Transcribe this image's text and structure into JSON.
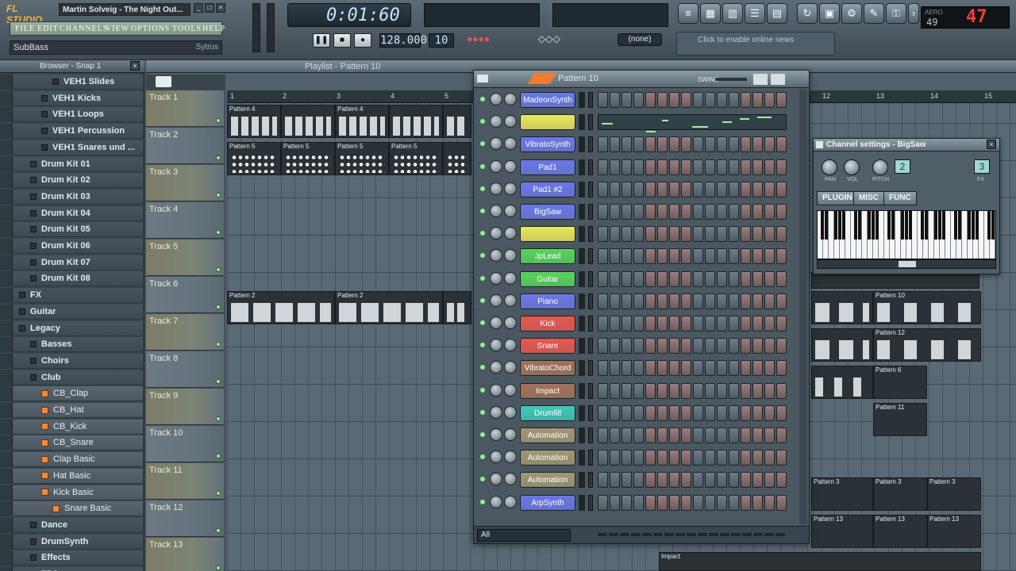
{
  "title": {
    "app": "FL STUDIO",
    "song": "Martin Solveig - The Night Out..."
  },
  "menu": [
    "FILE",
    "EDIT",
    "CHANNELS",
    "VIEW",
    "OPTIONS",
    "TOOLS",
    "HELP"
  ],
  "hint": {
    "left": "SubBass",
    "right": "Sytrus"
  },
  "transport": {
    "time": "0:01:60",
    "tempo": "128.000",
    "pattern": "10",
    "none_label": "(none)",
    "news": "Click to enable online news"
  },
  "cpu": {
    "label": "AERO",
    "value": "49",
    "big": "47"
  },
  "browser": {
    "title": "Browser - Snap 1",
    "items": [
      {
        "label": "VEH1 Slides",
        "type": "folder",
        "indent": 3
      },
      {
        "label": "VEH1 Kicks",
        "type": "folder",
        "indent": 2
      },
      {
        "label": "VEH1 Loops",
        "type": "folder",
        "indent": 2
      },
      {
        "label": "VEH1 Percussion",
        "type": "folder",
        "indent": 2
      },
      {
        "label": "VEH1 Snares und ...",
        "type": "folder",
        "indent": 2
      },
      {
        "label": "Drum Kit 01",
        "type": "folder",
        "indent": 1
      },
      {
        "label": "Drum Kit 02",
        "type": "folder",
        "indent": 1
      },
      {
        "label": "Drum Kit 03",
        "type": "folder",
        "indent": 1
      },
      {
        "label": "Drum Kit 04",
        "type": "folder",
        "indent": 1
      },
      {
        "label": "Drum Kit 05",
        "type": "folder",
        "indent": 1
      },
      {
        "label": "Drum Kit 06",
        "type": "folder",
        "indent": 1
      },
      {
        "label": "Drum Kit 07",
        "type": "folder",
        "indent": 1
      },
      {
        "label": "Drum Kit 08",
        "type": "folder",
        "indent": 1
      },
      {
        "label": "FX",
        "type": "folder",
        "indent": 0
      },
      {
        "label": "Guitar",
        "type": "folder",
        "indent": 0
      },
      {
        "label": "Legacy",
        "type": "folder",
        "indent": 0
      },
      {
        "label": "Basses",
        "type": "folder",
        "indent": 1
      },
      {
        "label": "Choirs",
        "type": "folder",
        "indent": 1
      },
      {
        "label": "Club",
        "type": "folder",
        "indent": 1
      },
      {
        "label": "CB_Clap",
        "type": "file",
        "indent": 2
      },
      {
        "label": "CB_Hat",
        "type": "file",
        "indent": 2
      },
      {
        "label": "CB_Kick",
        "type": "file",
        "indent": 2
      },
      {
        "label": "CB_Snare",
        "type": "file",
        "indent": 2
      },
      {
        "label": "Clap Basic",
        "type": "file",
        "indent": 2
      },
      {
        "label": "Hat Basic",
        "type": "file",
        "indent": 2
      },
      {
        "label": "Kick Basic",
        "type": "file",
        "indent": 2
      },
      {
        "label": "Snare Basic",
        "type": "file",
        "indent": 3
      },
      {
        "label": "Dance",
        "type": "folder",
        "indent": 1
      },
      {
        "label": "DrumSynth",
        "type": "folder",
        "indent": 1
      },
      {
        "label": "Effects",
        "type": "folder",
        "indent": 1
      },
      {
        "label": "FPC",
        "type": "folder",
        "indent": 1
      }
    ]
  },
  "playlist": {
    "title": "Playlist - Pattern 10",
    "tracks": [
      "Track 1",
      "Track 2",
      "Track 3",
      "Track 4",
      "Track 5",
      "Track 6",
      "Track 7",
      "Track 8",
      "Track 9",
      "Track 10",
      "Track 11",
      "Track 12",
      "Track 13"
    ],
    "ruler": [
      "1",
      "2",
      "3",
      "4",
      "5",
      "12",
      "13",
      "14",
      "15"
    ],
    "clips": {
      "pattern4": "Pattern 4",
      "pattern5": "Pattern 5",
      "pattern2": "Pattern 2",
      "pattern10": "Pattern 10",
      "pattern12": "Pattern 12",
      "pattern6": "Pattern 6",
      "pattern11": "Pattern 11",
      "pattern3": "Pattern 3",
      "pattern13": "Pattern 13",
      "impact": "Impact"
    }
  },
  "stepseq": {
    "title": "Pattern 10",
    "swing": "SWING",
    "filter": "All",
    "channels": [
      {
        "name": "MadeonSynth",
        "color": "#6a78e8"
      },
      {
        "name": "",
        "color": "#e8e85a"
      },
      {
        "name": "VibratoSynth",
        "color": "#6a78e8"
      },
      {
        "name": "Pad1",
        "color": "#6a78e8"
      },
      {
        "name": "Pad1 #2",
        "color": "#6a78e8"
      },
      {
        "name": "BigSaw",
        "color": "#6a78e8"
      },
      {
        "name": "",
        "color": "#e8e85a"
      },
      {
        "name": "JpLead",
        "color": "#58d45a"
      },
      {
        "name": "Guitar",
        "color": "#58d45a"
      },
      {
        "name": "Piano",
        "color": "#6a78e8"
      },
      {
        "name": "Kick",
        "color": "#e8574f"
      },
      {
        "name": "Snare",
        "color": "#e8574f"
      },
      {
        "name": "VibratoChord",
        "color": "#a3725a"
      },
      {
        "name": "Impact",
        "color": "#a3725a"
      },
      {
        "name": "Drumfill",
        "color": "#3fc9b9"
      },
      {
        "name": "Automation",
        "color": "#a09872"
      },
      {
        "name": "Automation",
        "color": "#a09872"
      },
      {
        "name": "Automation",
        "color": "#a09872"
      },
      {
        "name": "ArpSynth",
        "color": "#6a78e8"
      }
    ]
  },
  "channel_settings": {
    "title": "Channel settings - BigSaw",
    "knobs": [
      "PAN",
      "VOL",
      "PITCH"
    ],
    "lcd1": "2",
    "lcd2": "3",
    "fx_label": "FX",
    "tabs": [
      "PLUGIN",
      "MISC",
      "FUNC"
    ]
  }
}
